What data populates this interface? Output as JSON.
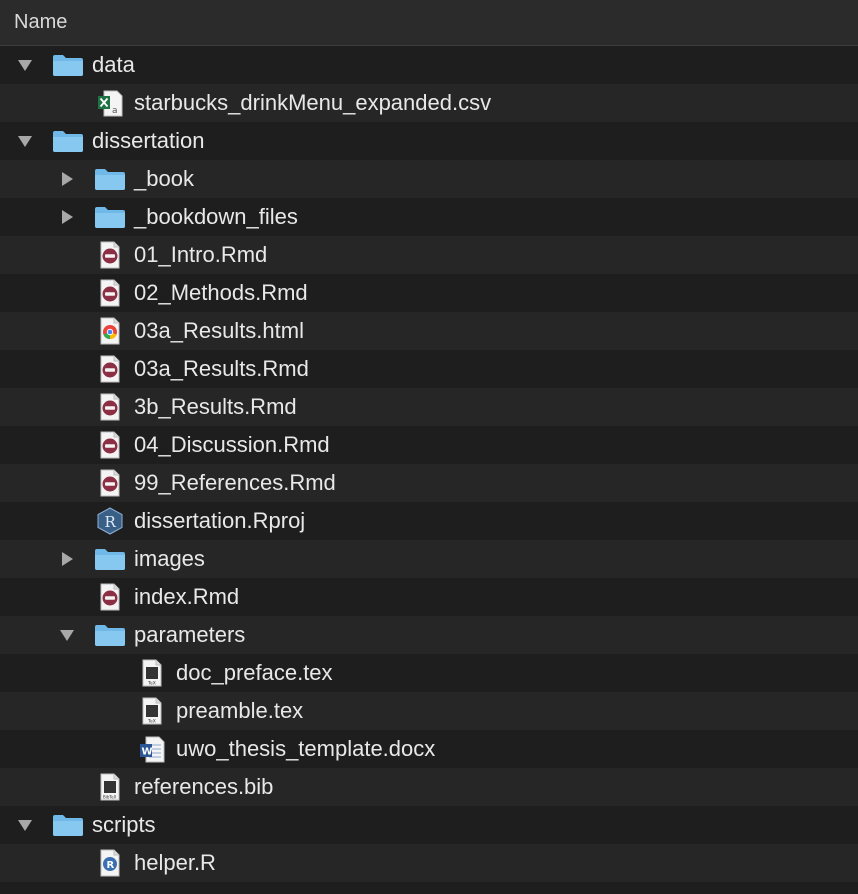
{
  "header": {
    "name_label": "Name"
  },
  "rows": [
    {
      "label": "data",
      "type": "folder",
      "depth": 0,
      "expanded": true,
      "icon": "folder-icon"
    },
    {
      "label": "starbucks_drinkMenu_expanded.csv",
      "type": "file",
      "depth": 1,
      "icon": "excel-csv-icon"
    },
    {
      "label": "dissertation",
      "type": "folder",
      "depth": 0,
      "expanded": true,
      "icon": "folder-icon"
    },
    {
      "label": "_book",
      "type": "folder",
      "depth": 1,
      "expanded": false,
      "icon": "folder-icon"
    },
    {
      "label": "_bookdown_files",
      "type": "folder",
      "depth": 1,
      "expanded": false,
      "icon": "folder-icon"
    },
    {
      "label": "01_Intro.Rmd",
      "type": "file",
      "depth": 1,
      "icon": "rmd-file-icon"
    },
    {
      "label": "02_Methods.Rmd",
      "type": "file",
      "depth": 1,
      "icon": "rmd-file-icon"
    },
    {
      "label": "03a_Results.html",
      "type": "file",
      "depth": 1,
      "icon": "chrome-html-icon"
    },
    {
      "label": "03a_Results.Rmd",
      "type": "file",
      "depth": 1,
      "icon": "rmd-file-icon"
    },
    {
      "label": "3b_Results.Rmd",
      "type": "file",
      "depth": 1,
      "icon": "rmd-file-icon"
    },
    {
      "label": "04_Discussion.Rmd",
      "type": "file",
      "depth": 1,
      "icon": "rmd-file-icon"
    },
    {
      "label": "99_References.Rmd",
      "type": "file",
      "depth": 1,
      "icon": "rmd-file-icon"
    },
    {
      "label": "dissertation.Rproj",
      "type": "file",
      "depth": 1,
      "icon": "rproj-icon"
    },
    {
      "label": "images",
      "type": "folder",
      "depth": 1,
      "expanded": false,
      "icon": "folder-icon"
    },
    {
      "label": "index.Rmd",
      "type": "file",
      "depth": 1,
      "icon": "rmd-file-icon"
    },
    {
      "label": "parameters",
      "type": "folder",
      "depth": 1,
      "expanded": true,
      "icon": "folder-icon"
    },
    {
      "label": "doc_preface.tex",
      "type": "file",
      "depth": 2,
      "icon": "tex-file-icon"
    },
    {
      "label": "preamble.tex",
      "type": "file",
      "depth": 2,
      "icon": "tex-file-icon"
    },
    {
      "label": "uwo_thesis_template.docx",
      "type": "file",
      "depth": 2,
      "icon": "word-docx-icon"
    },
    {
      "label": "references.bib",
      "type": "file",
      "depth": 1,
      "icon": "bibtex-file-icon"
    },
    {
      "label": "scripts",
      "type": "folder",
      "depth": 0,
      "expanded": true,
      "icon": "folder-icon"
    },
    {
      "label": "helper.R",
      "type": "file",
      "depth": 1,
      "icon": "r-script-icon"
    }
  ],
  "colors": {
    "folder_blue": "#6fb8e8",
    "rmd_red": "#8c2f45",
    "background_even": "#1e1e1e",
    "background_odd": "#262626"
  }
}
